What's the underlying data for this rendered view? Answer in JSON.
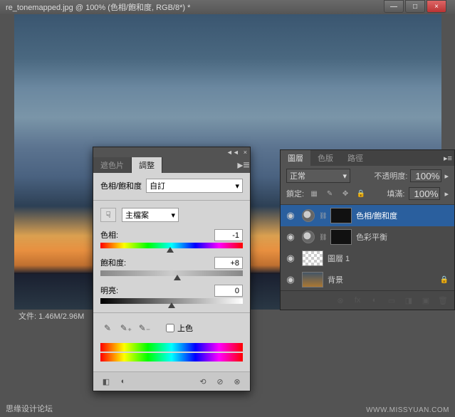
{
  "window": {
    "title": "re_tonemapped.jpg @ 100% (色相/飽和度, RGB/8*) *",
    "min": "—",
    "max": "□",
    "close": "×"
  },
  "file_info": "文件: 1.46M/2.96M",
  "adj_panel": {
    "collapse": "◄◄",
    "close": "×",
    "tabs": {
      "masks": "遮色片",
      "adjust": "調整"
    },
    "flyout": "▸≡",
    "type_label": "色相/飽和度",
    "preset": "自訂",
    "hand_icon": "☟",
    "channel": "主檔案",
    "hue": {
      "label": "色相:",
      "value": "-1"
    },
    "sat": {
      "label": "飽和度:",
      "value": "+8"
    },
    "light": {
      "label": "明亮:",
      "value": "0"
    },
    "eyedroppers": [
      "✎",
      "✎₊",
      "✎₋"
    ],
    "colorize": "上色",
    "footer": [
      "◧",
      "◐",
      "⟲",
      "⊘",
      "⊗"
    ]
  },
  "layers_panel": {
    "tabs": {
      "layers": "圖層",
      "channels": "色版",
      "paths": "路徑"
    },
    "flyout": "▸≡",
    "blend_mode": "正常",
    "opacity_label": "不透明度:",
    "opacity_value": "100%",
    "lock_label": "鎖定:",
    "lock_icons": [
      "▦",
      "✎",
      "✥",
      "🔒"
    ],
    "fill_label": "填滿:",
    "fill_value": "100%",
    "layers": [
      {
        "name": "色相/飽和度",
        "visible": "◉",
        "type": "adj"
      },
      {
        "name": "色彩平衡",
        "visible": "◉",
        "type": "adj"
      },
      {
        "name": "圖層 1",
        "visible": "◉",
        "type": "raster"
      },
      {
        "name": "背景",
        "visible": "◉",
        "type": "bg"
      }
    ],
    "footer": [
      "⊗",
      "fx",
      "◐",
      "▭",
      "◨",
      "▣",
      "🗑"
    ]
  },
  "watermark": {
    "cn": "思缘设计论坛",
    "en": "WWW.MISSYUAN.COM"
  }
}
